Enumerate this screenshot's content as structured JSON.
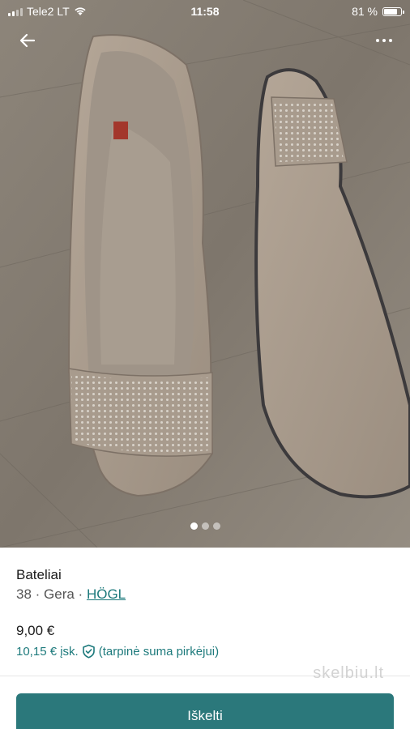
{
  "status_bar": {
    "carrier": "Tele2 LT",
    "time": "11:58",
    "battery": "81 %",
    "battery_level": 0.81
  },
  "gallery": {
    "image_count": 3,
    "active_index": 0
  },
  "listing": {
    "title": "Bateliai",
    "size": "38",
    "condition": "Gera",
    "separator": " · ",
    "brand": "HÖGL",
    "price": "9,00 €",
    "price_incl": "10,15 € įsk.",
    "price_incl_note": "(tarpinė suma pirkėjui)"
  },
  "watermark": "skelbiu.lt",
  "actions": {
    "primary_label": "Iškelti"
  },
  "colors": {
    "accent": "#2b787b",
    "link": "#1d7a7c"
  }
}
